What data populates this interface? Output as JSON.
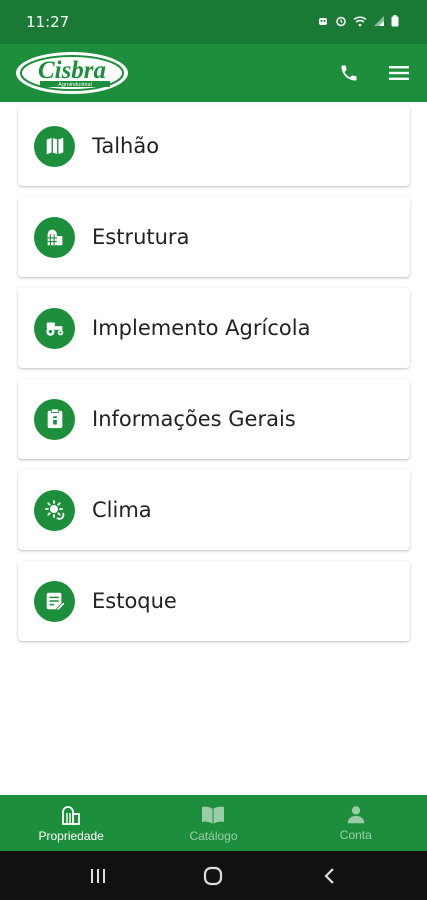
{
  "status_bar": {
    "time": "11:27",
    "icons": [
      "android-icon",
      "alarm-icon",
      "wifi-icon",
      "signal-icon",
      "battery-icon"
    ]
  },
  "appbar": {
    "logo_text": "Cisbra",
    "logo_subtext": "Agroindustrial",
    "actions": [
      "phone-icon",
      "menu-icon"
    ]
  },
  "menu": {
    "items": [
      {
        "label": "Talhão",
        "icon": "map-icon"
      },
      {
        "label": "Estrutura",
        "icon": "silo-icon"
      },
      {
        "label": "Implemento Agrícola",
        "icon": "tractor-icon"
      },
      {
        "label": "Informações Gerais",
        "icon": "clipboard-icon"
      },
      {
        "label": "Clima",
        "icon": "weather-icon"
      },
      {
        "label": "Estoque",
        "icon": "inventory-icon"
      }
    ]
  },
  "bottom_nav": {
    "items": [
      {
        "label": "Propriedade",
        "icon": "silo-icon",
        "active": true
      },
      {
        "label": "Catálogo",
        "icon": "book-icon",
        "active": false
      },
      {
        "label": "Conta",
        "icon": "person-icon",
        "active": false
      }
    ]
  },
  "colors": {
    "primary": "#1d8f3c",
    "status_bar": "#1a7a35",
    "system_nav": "#111111"
  }
}
